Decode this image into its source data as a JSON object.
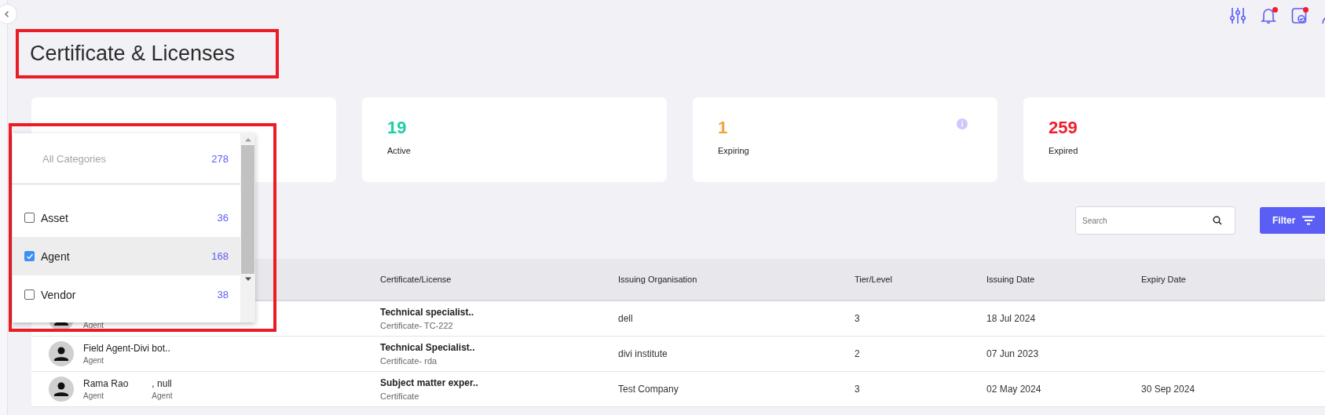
{
  "page": {
    "title": "Certificate & Licenses",
    "title_highlighted": true
  },
  "header_icons": [
    {
      "kind": "sliders",
      "badge": false
    },
    {
      "kind": "bell",
      "badge": true
    },
    {
      "kind": "calendar",
      "badge": true
    },
    {
      "kind": "user"
    }
  ],
  "stats": [
    {
      "kind": "covered"
    },
    {
      "kind": "number",
      "value": "19",
      "label": "Active",
      "color": "#1ccfa3",
      "info": false
    },
    {
      "kind": "number",
      "value": "1",
      "label": "Expiring",
      "color": "#f7a23b",
      "info": true
    },
    {
      "kind": "number",
      "value": "259",
      "label": "Expired",
      "color": "#f21d2f",
      "info": false
    }
  ],
  "search": {
    "placeholder": "Search"
  },
  "filter_button": {
    "label": "Filter"
  },
  "table": {
    "columns": [
      "Certificate/License",
      "Issuing Organisation",
      "Tier/Level",
      "Issuing Date",
      "Expiry Date"
    ],
    "rows": [
      {
        "people": [
          {
            "role": "Agent"
          }
        ],
        "certificate": "Technical specialist..",
        "certificate_type": "Certificate- TC-222",
        "organisation": "dell",
        "tier": "3",
        "issuing_date": "18 Jul 2024"
      },
      {
        "people": [
          {
            "name": "Field Agent-Divi bot..",
            "role": "Agent"
          }
        ],
        "certificate": "Technical Specialist..",
        "certificate_type": "Certificate- rda",
        "organisation": "divi institute",
        "tier": "2",
        "issuing_date": "07 Jun 2023"
      },
      {
        "people": [
          {
            "name": "Rama Rao",
            "role": "Agent"
          },
          {
            "name": ", null",
            "role": "Agent"
          }
        ],
        "certificate": "Subject matter exper..",
        "certificate_type": "Certificate",
        "organisation": "Test Company",
        "tier": "3",
        "issuing_date": "02 May 2024",
        "expiry_date": "30 Sep 2024"
      }
    ]
  },
  "category_dropdown": {
    "highlighted": true,
    "all": {
      "label": "All Categories",
      "count": "278"
    },
    "options": [
      {
        "label": "Asset",
        "count": "36",
        "checked": false,
        "hovered": false
      },
      {
        "label": "Agent",
        "count": "168",
        "checked": true,
        "hovered": true
      },
      {
        "label": "Vendor",
        "count": "38",
        "checked": false,
        "hovered": false
      }
    ]
  }
}
